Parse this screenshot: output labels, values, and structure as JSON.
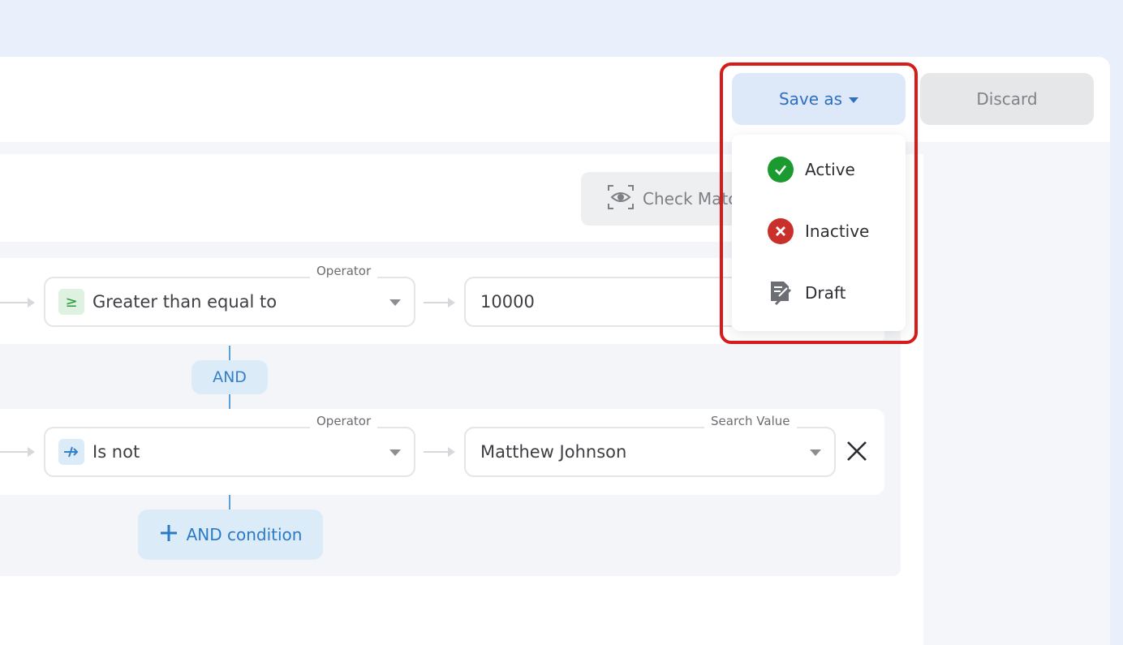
{
  "toolbar": {
    "save_as_label": "Save as",
    "discard_label": "Discard"
  },
  "check_match_label": "Check Matc",
  "conditions": [
    {
      "operator_label": "Operator",
      "operator_value": "Greater than equal to",
      "operator_icon": "greater-than-equal-icon",
      "value": "10000"
    },
    {
      "operator_label": "Operator",
      "operator_value": "Is not",
      "operator_icon": "not-equal-icon",
      "search_label": "Search Value",
      "value": "Matthew Johnson"
    }
  ],
  "connector_label": "AND",
  "add_condition_label": "AND condition",
  "save_as_menu": [
    {
      "label": "Active",
      "icon": "check-circle-icon",
      "color": "#1a9a2f"
    },
    {
      "label": "Inactive",
      "icon": "x-circle-icon",
      "color": "#c9302c"
    },
    {
      "label": "Draft",
      "icon": "draft-document-icon",
      "color": "#6b6e73"
    }
  ],
  "colors": {
    "accent": "#2e6fbf",
    "highlight": "#d61b1b"
  }
}
